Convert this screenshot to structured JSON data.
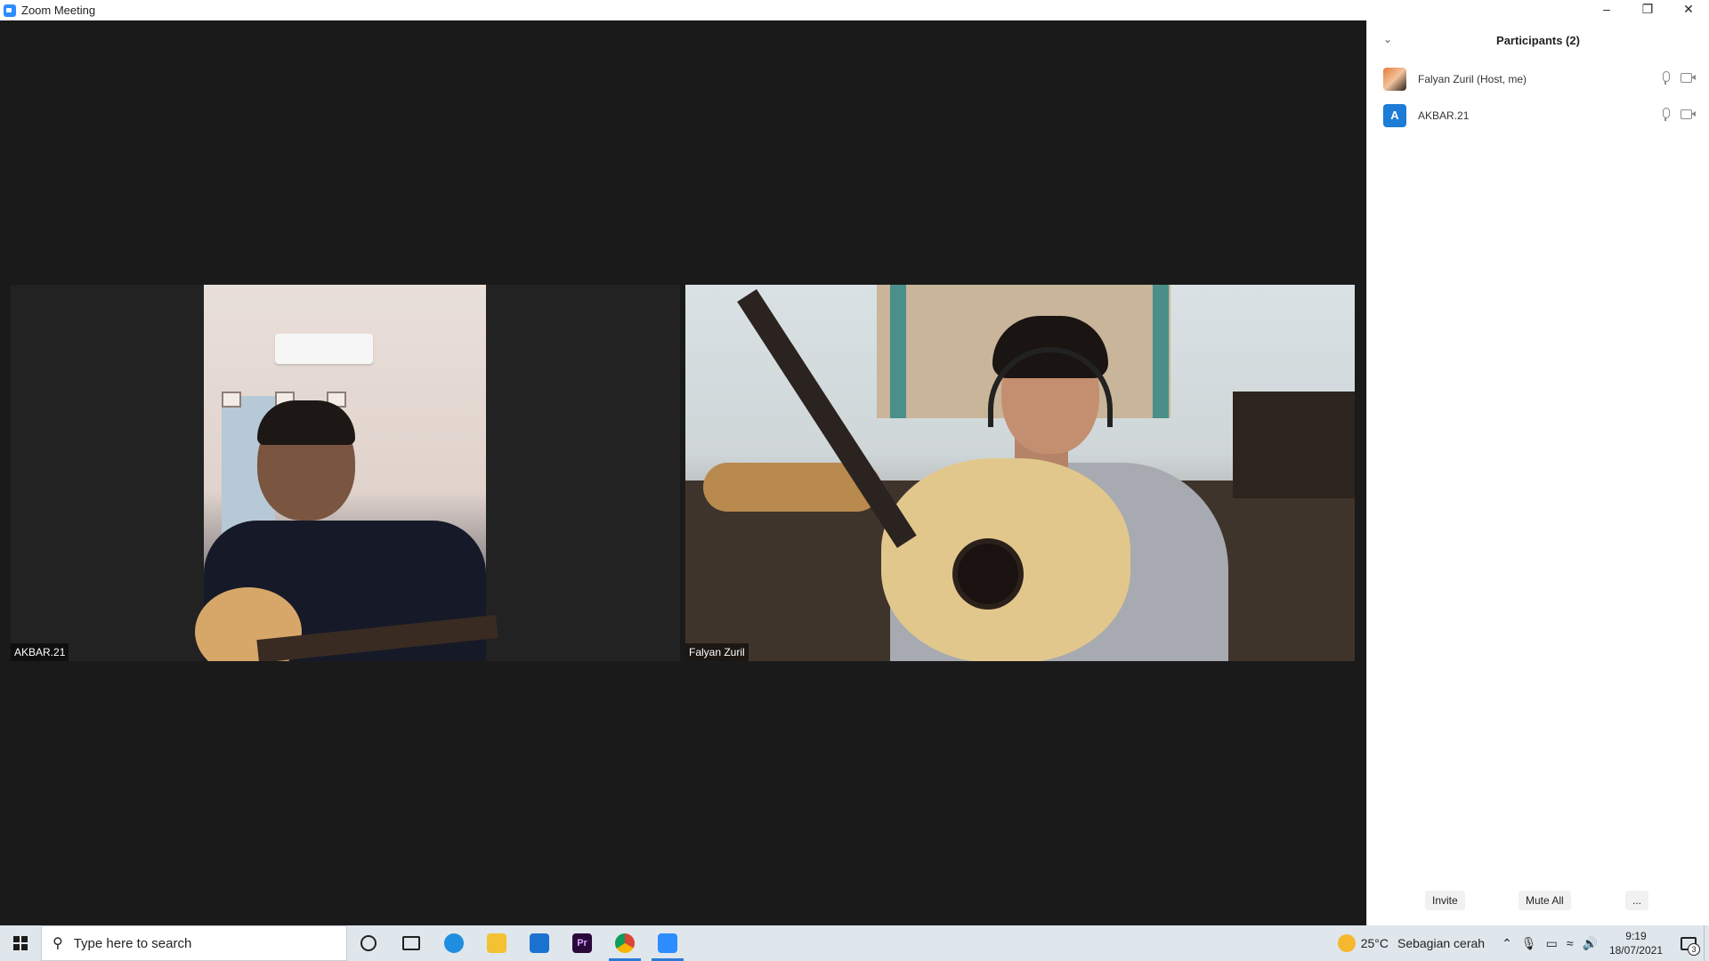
{
  "window": {
    "title": "Zoom Meeting",
    "controls": [
      "–",
      "❐",
      "✕"
    ]
  },
  "tiles": [
    {
      "name": "AKBAR.21"
    },
    {
      "name": "Falyan Zuril"
    }
  ],
  "participants_panel": {
    "title": "Participants (2)",
    "collapse_icon": "chevron-down-icon",
    "participants": [
      {
        "name": "Falyan Zuril (Host, me)",
        "avatar": "photo",
        "avatar_letter": ""
      },
      {
        "name": "AKBAR.21",
        "avatar": "letter",
        "avatar_letter": "A"
      }
    ],
    "buttons": {
      "invite": "Invite",
      "mute_all": "Mute All",
      "more": "..."
    }
  },
  "taskbar": {
    "search_placeholder": "Type here to search",
    "pinned": [
      "cortana-icon",
      "task-view-icon",
      "edge-icon",
      "file-explorer-icon",
      "mail-icon",
      "premiere-icon",
      "chrome-icon",
      "zoom-icon"
    ],
    "premiere_label": "Pr",
    "weather_temp": "25°C",
    "weather_text": "Sebagian cerah",
    "time": "9:19",
    "date": "18/07/2021",
    "notification_count": "3"
  },
  "colors": {
    "zoom_blue": "#2d8cff",
    "stage_bg": "#1a1a1a",
    "avatar_letter_bg": "#1c7cd6"
  }
}
